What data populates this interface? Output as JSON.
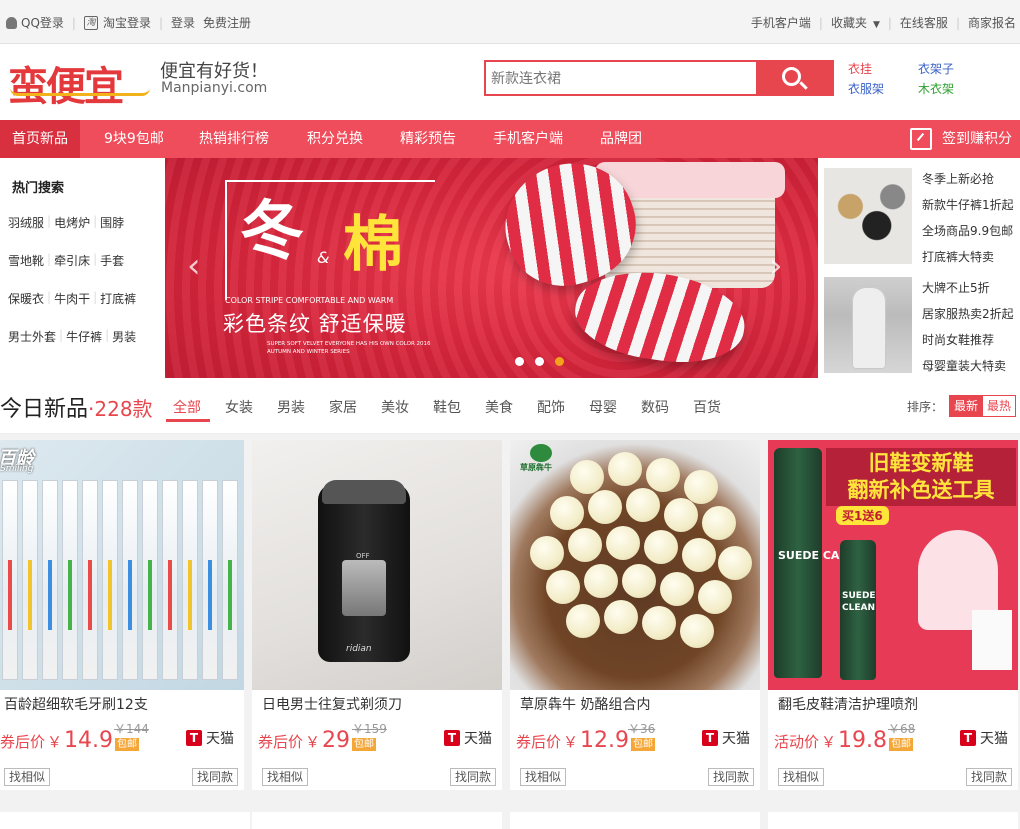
{
  "topbar": {
    "qq_login": "QQ登录",
    "taobao_login": "淘宝登录",
    "login": "登录",
    "register": "免费注册",
    "mobile": "手机客户端",
    "favorites": "收藏夹",
    "service": "在线客服",
    "merchant": "商家报名"
  },
  "header": {
    "logo": "蛮便宜",
    "slogan": "便宜有好货！",
    "domain": "Manpianyi.com",
    "search_placeholder": "新款连衣裙",
    "hotwords": [
      "衣挂",
      "衣架子",
      "衣服架",
      "木衣架"
    ]
  },
  "nav": {
    "items": [
      "首页新品",
      "9块9包邮",
      "热销排行榜",
      "积分兑换",
      "精彩预告",
      "手机客户端",
      "品牌团"
    ],
    "signin": "签到赚积分"
  },
  "hot_search": {
    "title": "热门搜索",
    "rows": [
      [
        "羽绒服",
        "电烤炉",
        "围脖"
      ],
      [
        "雪地靴",
        "牵引床",
        "手套"
      ],
      [
        "保暖衣",
        "牛肉干",
        "打底裤"
      ],
      [
        "男士外套",
        "牛仔裤",
        "男装"
      ]
    ]
  },
  "banner": {
    "title1": "冬",
    "amp": "&",
    "title2": "棉",
    "en1": "COLOR STRIPE COMFORTABLE AND WARM",
    "cn": "彩色条纹  舒适保暖",
    "en2": "SUPER SOFT VELVET  EVERYONE HAS HIS OWN COLOR 2016 AUTUMN AND WINTER SERIES",
    "prev": "‹",
    "next": "›",
    "active_slide": 3,
    "slide_count": 3
  },
  "promo": {
    "group1": [
      "冬季上新必抢",
      "新款牛仔裤1折起",
      "全场商品9.9包邮",
      "打底裤大特卖"
    ],
    "group2": [
      "大牌不止5折",
      "居家服热卖2折起",
      "时尚女鞋推荐",
      "母婴童装大特卖"
    ]
  },
  "today": {
    "title": "今日新品",
    "count": "·228款",
    "tabs": [
      "全部",
      "女装",
      "男装",
      "家居",
      "美妆",
      "鞋包",
      "美食",
      "配饰",
      "母婴",
      "数码",
      "百货"
    ],
    "active_tab": "全部",
    "sort_label": "排序：",
    "sort_new": "最新",
    "sort_hot": "最热"
  },
  "products": [
    {
      "name": "百龄超细软毛牙刷12支",
      "orig": "￥144",
      "label": "券后价",
      "yen": "￥",
      "price": "14.9",
      "ship": "包邮",
      "store": "天猫",
      "similar": "找相似",
      "same": "找同款",
      "brand": "百龄",
      "brand_en": "Smiling"
    },
    {
      "name": "日电男士往复式剃须刀",
      "orig": "￥159",
      "label": "券后价",
      "yen": "￥",
      "price": "29",
      "ship": "包邮",
      "store": "天猫",
      "similar": "找相似",
      "same": "找同款",
      "off": "OFF",
      "logo": "ridian"
    },
    {
      "name": "草原犇牛 奶酪组合内",
      "orig": "￥36",
      "label": "券后价",
      "yen": "￥",
      "price": "12.9",
      "ship": "包邮",
      "store": "天猫",
      "similar": "找相似",
      "same": "找同款",
      "brand": "草原犇牛"
    },
    {
      "name": "翻毛皮鞋清洁护理喷剂",
      "orig": "￥68",
      "label": "活动价",
      "yen": "￥",
      "price": "19.8",
      "ship": "包邮",
      "store": "天猫",
      "similar": "找相似",
      "same": "找同款",
      "headline1": "旧鞋变新鞋",
      "headline2": "翻新补色送工具",
      "buy": "买1送6",
      "bottle1": "SUEDE CARE",
      "bottle2": "SUEDE CLEAN"
    }
  ],
  "colors": {
    "accent": "#e8464e",
    "nav": "#ef4d5b",
    "tmall": "#d9001b",
    "ship_badge": "#f4a637"
  }
}
